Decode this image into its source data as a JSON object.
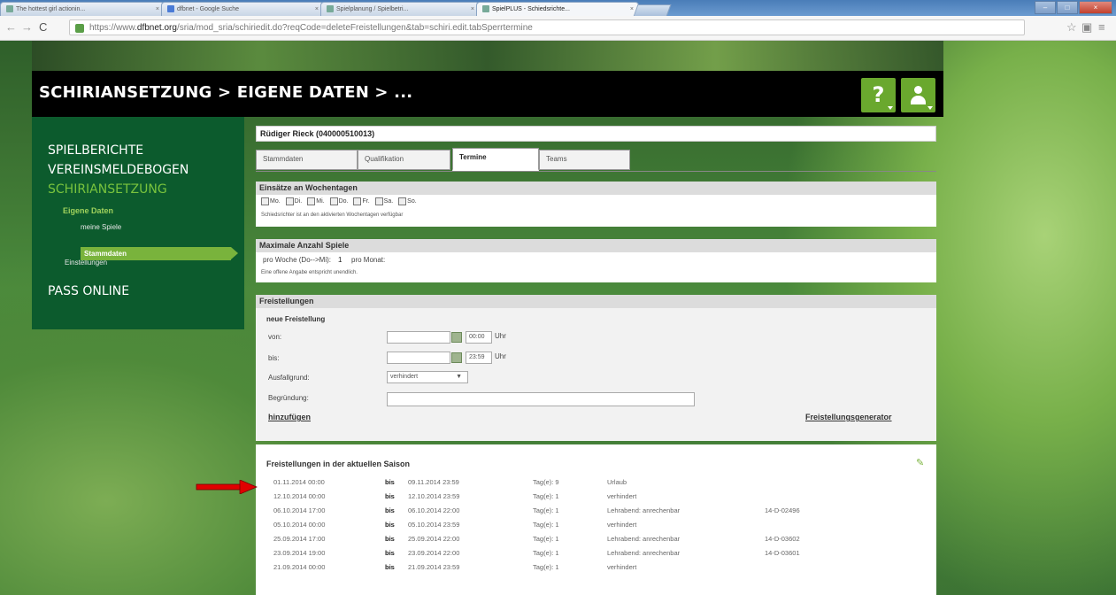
{
  "browser": {
    "tabs": [
      {
        "label": "The hottest girl actionin...",
        "active": false
      },
      {
        "label": "dfbnet - Google Suche",
        "active": false
      },
      {
        "label": "Spielplanung / Spielbetri...",
        "active": false
      },
      {
        "label": "SpielPLUS - Schiedsrichte...",
        "active": true
      }
    ],
    "url_prefix": "https://www.",
    "url_host": "dfbnet.org",
    "url_path": "/sria/mod_sria/schiriedit.do?reqCode=deleteFreistellungen&tab=schiri.edit.tabSperrtermine"
  },
  "header": {
    "title": "SCHIRIANSETZUNG > EIGENE DATEN > ...",
    "help_label": "?"
  },
  "sidebar": {
    "main_items": [
      "SPIELBERICHTE",
      "VEREINSMELDEBOGEN",
      "SCHIRIANSETZUNG"
    ],
    "sub_item": "Eigene Daten",
    "subsub_items": [
      "meine Spiele"
    ],
    "active_item": "Stammdaten",
    "settings_item": "Einstellungen",
    "bottom_item": "PASS ONLINE"
  },
  "person": {
    "name": "Rüdiger Rieck (040000510013)"
  },
  "tabs": [
    "Stammdaten",
    "Qualifikation",
    "Termine",
    "Teams"
  ],
  "active_tab": "Termine",
  "weekdays": {
    "heading": "Einsätze an Wochentagen",
    "days": [
      "Mo.",
      "Di.",
      "Mi.",
      "Do.",
      "Fr.",
      "Sa.",
      "So."
    ],
    "note": "Schiedsrichter ist an den aktivierten Wochentagen verfügbar"
  },
  "max_games": {
    "heading": "Maximale Anzahl Spiele",
    "per_week_label": "pro Woche (Do-->Mi):",
    "per_week_value": "1",
    "per_month_label": "pro Monat:",
    "note": "Eine offene Angabe entspricht unendlich."
  },
  "freistellungen": {
    "heading": "Freistellungen",
    "new_heading": "neue Freistellung",
    "von_label": "von:",
    "von_time": "00:00",
    "bis_label": "bis:",
    "bis_time": "23:59",
    "uhr": "Uhr",
    "ausfallgrund_label": "Ausfallgrund:",
    "ausfallgrund_value": "verhindert",
    "begruendung_label": "Begründung:",
    "add_link": "hinzufügen",
    "generator_link": "Freistellungsgenerator"
  },
  "season": {
    "heading": "Freistellungen in der aktuellen Saison",
    "bis": "bis",
    "rows": [
      {
        "from": "01.11.2014 00:00",
        "to": "09.11.2014 23:59",
        "days": "Tag(e): 9",
        "reason": "Urlaub",
        "code": ""
      },
      {
        "from": "12.10.2014 00:00",
        "to": "12.10.2014 23:59",
        "days": "Tag(e): 1",
        "reason": "verhindert",
        "code": ""
      },
      {
        "from": "06.10.2014 17:00",
        "to": "06.10.2014 22:00",
        "days": "Tag(e): 1",
        "reason": "Lehrabend: anrechenbar",
        "code": "14-D-02496"
      },
      {
        "from": "05.10.2014 00:00",
        "to": "05.10.2014 23:59",
        "days": "Tag(e): 1",
        "reason": "verhindert",
        "code": ""
      },
      {
        "from": "25.09.2014 17:00",
        "to": "25.09.2014 22:00",
        "days": "Tag(e): 1",
        "reason": "Lehrabend: anrechenbar",
        "code": "14-D-03602"
      },
      {
        "from": "23.09.2014 19:00",
        "to": "23.09.2014 22:00",
        "days": "Tag(e): 1",
        "reason": "Lehrabend: anrechenbar",
        "code": "14-D-03601"
      },
      {
        "from": "21.09.2014 00:00",
        "to": "21.09.2014 23:59",
        "days": "Tag(e): 1",
        "reason": "verhindert",
        "code": ""
      }
    ]
  },
  "colors": {
    "header_bg": "#000000",
    "sidebar_bg": "#0c5b2d",
    "accent": "#79b33c",
    "arrow": "#e00000"
  }
}
